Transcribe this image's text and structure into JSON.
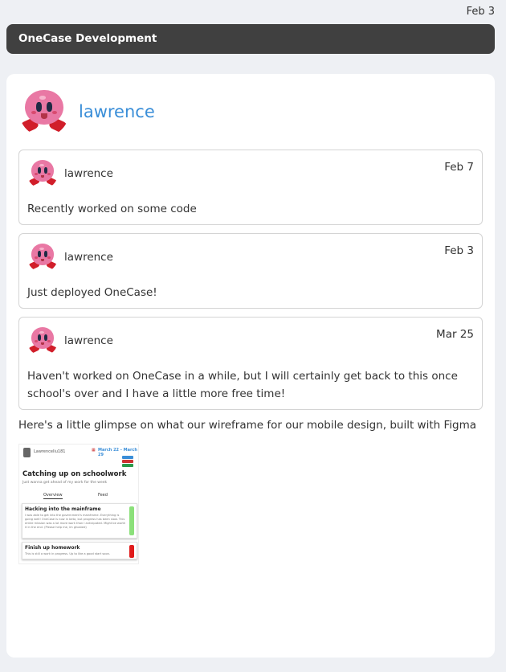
{
  "page": {
    "top_date": "Feb 3"
  },
  "banner": {
    "title": "OneCase Development"
  },
  "profile": {
    "name": "lawrence",
    "avatar_icon": "kirby-avatar-icon"
  },
  "posts": [
    {
      "author": "lawrence",
      "date": "Feb 7",
      "text": "Recently worked on some code"
    },
    {
      "author": "lawrence",
      "date": "Feb 3",
      "text": "Just deployed OneCase!"
    },
    {
      "author": "lawrence",
      "date": "Mar 25",
      "text": "Haven't worked on OneCase in a while, but I will certainly get back to this once school's over and I have a little more free time!"
    }
  ],
  "caption": "Here's a little glimpse on what our wireframe for our mobile design, built with Figma",
  "wireframe": {
    "user": "Lawrenceliu181",
    "date_range": "March 22 - March 29",
    "title": "Catching up on schoolwork",
    "subtitle": "Just wanna get ahead of my work for the week",
    "tabs": [
      "Overview",
      "Feed"
    ],
    "tasks": [
      {
        "title": "Hacking into the mainframe",
        "body": "I was able to get into the government's mainframe. Everything is going well! OneCase is now in beta, but progress has been slow. This entire mission was a lot more work than I anticipated. Might be worth it in the end. (Please help me, im ghosted)"
      },
      {
        "title": "Finish up homework",
        "body": "This is still a work in progress. Up to like a good start soon."
      }
    ],
    "colors": {
      "done": "#8be07a",
      "todo": "#e01b1b"
    }
  },
  "colors": {
    "banner": "#404040",
    "accent": "#3a8ed8",
    "background": "#eef0f4"
  }
}
